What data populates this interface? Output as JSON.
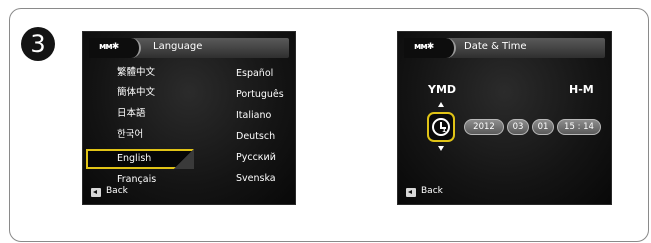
{
  "step": {
    "number": "3"
  },
  "language_screen": {
    "title": "Language",
    "languages_left": [
      "繁體中文",
      "簡体中文",
      "日本語",
      "한국어",
      "English",
      "Français"
    ],
    "languages_right": [
      "Español",
      "Português",
      "Italiano",
      "Deutsch",
      "Русский",
      "Svenska"
    ],
    "selected": "English",
    "back_label": "Back"
  },
  "date_time_screen": {
    "title": "Date & Time",
    "date_format": "YMD",
    "time_format": "H-M",
    "year": "2012",
    "month": "03",
    "day": "01",
    "time": "15 : 14",
    "back_label": "Back"
  },
  "colors": {
    "selection_accent": "#e0c316",
    "screen_background": "#101010"
  },
  "icons": {
    "tab_icon": "settings-tab-icon",
    "clock": "clock-icon",
    "back": "back-icon"
  }
}
